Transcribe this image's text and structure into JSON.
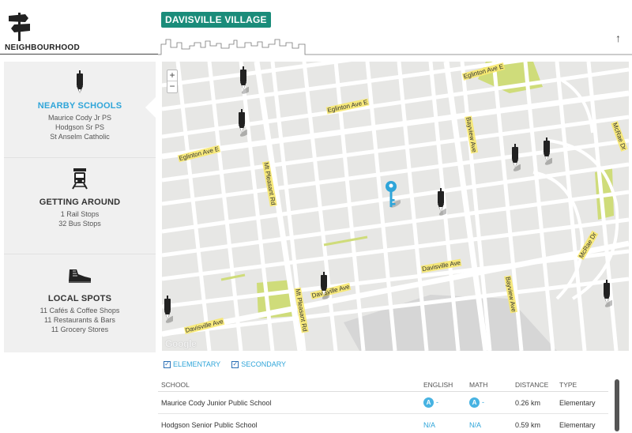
{
  "header": {
    "section_label": "NEIGHBOURHOOD",
    "brand": "DAVISVILLE VILLAGE",
    "scroll_top_glyph": "↑"
  },
  "sidebar": {
    "items": [
      {
        "title": "NEARBY SCHOOLS",
        "icon": "pencil-icon",
        "active": true,
        "lines": [
          "Maurice Cody Jr PS",
          "Hodgson Sr PS",
          "St Anselm Catholic"
        ]
      },
      {
        "title": "GETTING AROUND",
        "icon": "train-icon",
        "active": false,
        "lines": [
          "1 Rail Stops",
          "32 Bus Stops"
        ]
      },
      {
        "title": "LOCAL SPOTS",
        "icon": "sneaker-icon",
        "active": false,
        "lines": [
          "11 Cafés & Coffee Shops",
          "11 Restaurants & Bars",
          "11 Grocery Stores"
        ]
      }
    ]
  },
  "map": {
    "zoom_in": "+",
    "zoom_out": "−",
    "attribution": "Google",
    "streets": [
      "Eglinton Ave E",
      "Eglinton Ave E",
      "Eglinton Ave E",
      "Mt Pleasant Rd",
      "Bayview Ave",
      "Davisville Ave",
      "Davisville Ave",
      "Davisville Ave",
      "Mt Pleasant Rd",
      "Bayview Ave",
      "McRae Dr",
      "McRae Dr"
    ]
  },
  "filters": {
    "elementary": {
      "label": "ELEMENTARY",
      "checked": true
    },
    "secondary": {
      "label": "SECONDARY",
      "checked": true
    }
  },
  "table": {
    "headers": {
      "school": "SCHOOL",
      "english": "ENGLISH",
      "math": "MATH",
      "distance": "DISTANCE",
      "type": "TYPE"
    },
    "rows": [
      {
        "school": "Maurice Cody Junior Public School",
        "english": "A",
        "english_suffix": "-",
        "math": "A",
        "math_suffix": "-",
        "distance": "0.26 km",
        "type": "Elementary"
      },
      {
        "school": "Hodgson Senior Public School",
        "english": "N/A",
        "math": "N/A",
        "distance": "0.59 km",
        "type": "Elementary"
      }
    ]
  },
  "colors": {
    "accent": "#2fa5d9",
    "brand": "#1a8c7a",
    "park": "#cfdc7a",
    "road_label": "#f7e86e"
  }
}
